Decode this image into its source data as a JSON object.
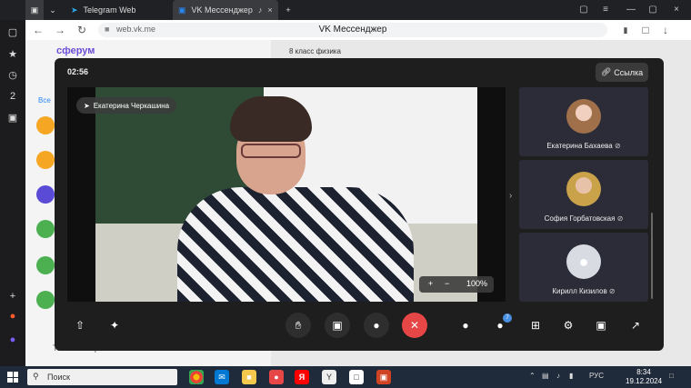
{
  "browser": {
    "tabs": [
      {
        "label": "Telegram Web"
      },
      {
        "label": "VK Мессенджер"
      }
    ],
    "url": "web.vk.me",
    "page_title": "VK Мессенджер",
    "new_tab": "+"
  },
  "left_bar": {
    "badge_number": "2"
  },
  "vk": {
    "brand": "сферум",
    "chat_name": "8 класс физика",
    "filter_tab": "Все",
    "unread_only": "Только непрочитанные"
  },
  "call": {
    "timer": "02:56",
    "link_label": "Ссылка",
    "speaker_name": "Екатерина Черкашина",
    "zoom": {
      "plus": "+",
      "minus": "−",
      "level": "100%"
    },
    "participants": [
      {
        "name": "Екатерина Бахаева"
      },
      {
        "name": "София Горбатовская"
      },
      {
        "name": "Кирилл Кизилов"
      }
    ],
    "participants_badge": "7"
  },
  "taskbar": {
    "search_placeholder": "Поиск",
    "lang": "РУС",
    "time": "8:34",
    "date": "19.12.2024"
  },
  "colors": {
    "hangup": "#e64646",
    "badge": "#4a90e2"
  }
}
